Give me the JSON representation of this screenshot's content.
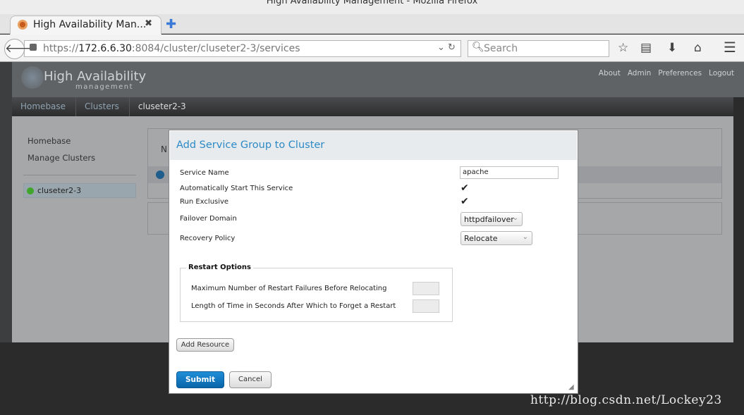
{
  "window": {
    "title": "High Availability Management - Mozilla Firefox"
  },
  "browser": {
    "tab_title": "High Availability Man...",
    "url_prefix": "https://",
    "url_host": "172.6.6.30",
    "url_rest": ":8084/cluster/cluseter2-3/services",
    "search_placeholder": "Search"
  },
  "app": {
    "brand": "High Availability",
    "brand_sub": "management",
    "top_links": [
      "About",
      "Admin",
      "Preferences",
      "Logout"
    ],
    "breadcrumb": [
      "Homebase",
      "Clusters",
      "cluseter2-3"
    ],
    "sidebar": {
      "items": [
        "Homebase",
        "Manage Clusters"
      ],
      "cluster": "cluseter2-3",
      "cluster_status_color": "#3fa62b"
    },
    "bg_letter": "N"
  },
  "modal": {
    "title": "Add Service Group to Cluster",
    "service_name_label": "Service Name",
    "service_name_value": "apache",
    "auto_start_label": "Automatically Start This Service",
    "auto_start_checked": true,
    "run_exclusive_label": "Run Exclusive",
    "run_exclusive_checked": true,
    "failover_label": "Failover Domain",
    "failover_value": "httpdfailover",
    "recovery_label": "Recovery Policy",
    "recovery_value": "Relocate",
    "restart_legend": "Restart Options",
    "max_restart_label": "Maximum Number of Restart Failures Before Relocating",
    "max_restart_value": "",
    "forget_label": "Length of Time in Seconds After Which to Forget a Restart",
    "forget_value": "",
    "add_resource": "Add Resource",
    "submit": "Submit",
    "cancel": "Cancel"
  },
  "watermark": "http://blog.csdn.net/Lockey23"
}
